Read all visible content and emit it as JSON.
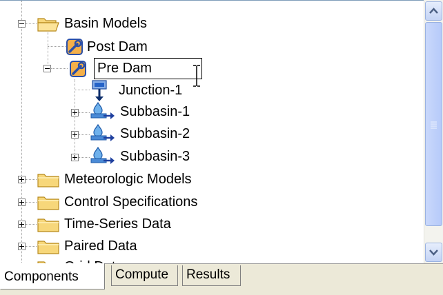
{
  "tree": {
    "items": [
      {
        "label": "Basin Models",
        "icon": "folder-open-icon",
        "expander": "minus"
      },
      {
        "label": "Post Dam",
        "icon": "basin-model-icon",
        "expander": "none"
      },
      {
        "label": "Pre Dam",
        "icon": "basin-model-icon",
        "expander": "minus",
        "editing": true
      },
      {
        "label": "Junction-1",
        "icon": "junction-icon",
        "expander": "none"
      },
      {
        "label": "Subbasin-1",
        "icon": "subbasin-icon",
        "expander": "plus"
      },
      {
        "label": "Subbasin-2",
        "icon": "subbasin-icon",
        "expander": "plus"
      },
      {
        "label": "Subbasin-3",
        "icon": "subbasin-icon",
        "expander": "plus"
      },
      {
        "label": "Meteorologic Models",
        "icon": "folder-icon",
        "expander": "plus"
      },
      {
        "label": "Control Specifications",
        "icon": "folder-icon",
        "expander": "plus"
      },
      {
        "label": "Time-Series Data",
        "icon": "folder-icon",
        "expander": "plus"
      },
      {
        "label": "Paired Data",
        "icon": "folder-icon",
        "expander": "plus"
      },
      {
        "label": "Grid Data",
        "icon": "folder-icon",
        "expander": "plus"
      }
    ]
  },
  "tabs": [
    {
      "label": "Components",
      "active": true
    },
    {
      "label": "Compute",
      "active": false
    },
    {
      "label": "Results",
      "active": false
    }
  ],
  "colors": {
    "folder_fill": "#f7d77a",
    "folder_stroke": "#b78a1f",
    "scroll_accent": "#c4d4f5"
  }
}
